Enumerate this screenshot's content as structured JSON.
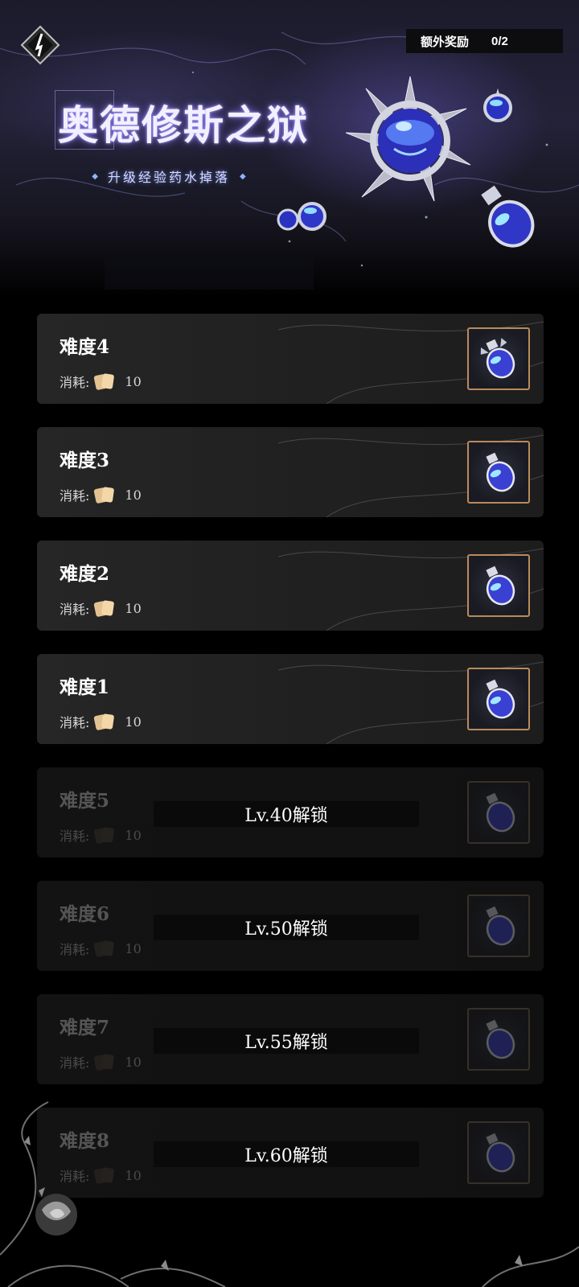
{
  "header": {
    "bonus_label": "额外奖励",
    "bonus_count": "0/2",
    "title": "奥德修斯之狱",
    "subtitle": "升级经验药水掉落"
  },
  "icons": {
    "back": "back-arrow-icon",
    "cost": "scroll-ticket-icon",
    "reward": "exp-potion-icon"
  },
  "colors": {
    "card_bg": "#262626",
    "reward_border": "#b98a5c",
    "title_glow": "#8c78ff"
  },
  "cost_label": "消耗:",
  "stages": [
    {
      "name": "难度4",
      "cost": "10",
      "locked": false
    },
    {
      "name": "难度3",
      "cost": "10",
      "locked": false
    },
    {
      "name": "难度2",
      "cost": "10",
      "locked": false
    },
    {
      "name": "难度1",
      "cost": "10",
      "locked": false
    },
    {
      "name": "难度5",
      "cost": "10",
      "locked": true,
      "unlock_text": "Lv.40解锁"
    },
    {
      "name": "难度6",
      "cost": "10",
      "locked": true,
      "unlock_text": "Lv.50解锁"
    },
    {
      "name": "难度7",
      "cost": "10",
      "locked": true,
      "unlock_text": "Lv.55解锁"
    },
    {
      "name": "难度8",
      "cost": "10",
      "locked": true,
      "unlock_text": "Lv.60解锁"
    }
  ]
}
